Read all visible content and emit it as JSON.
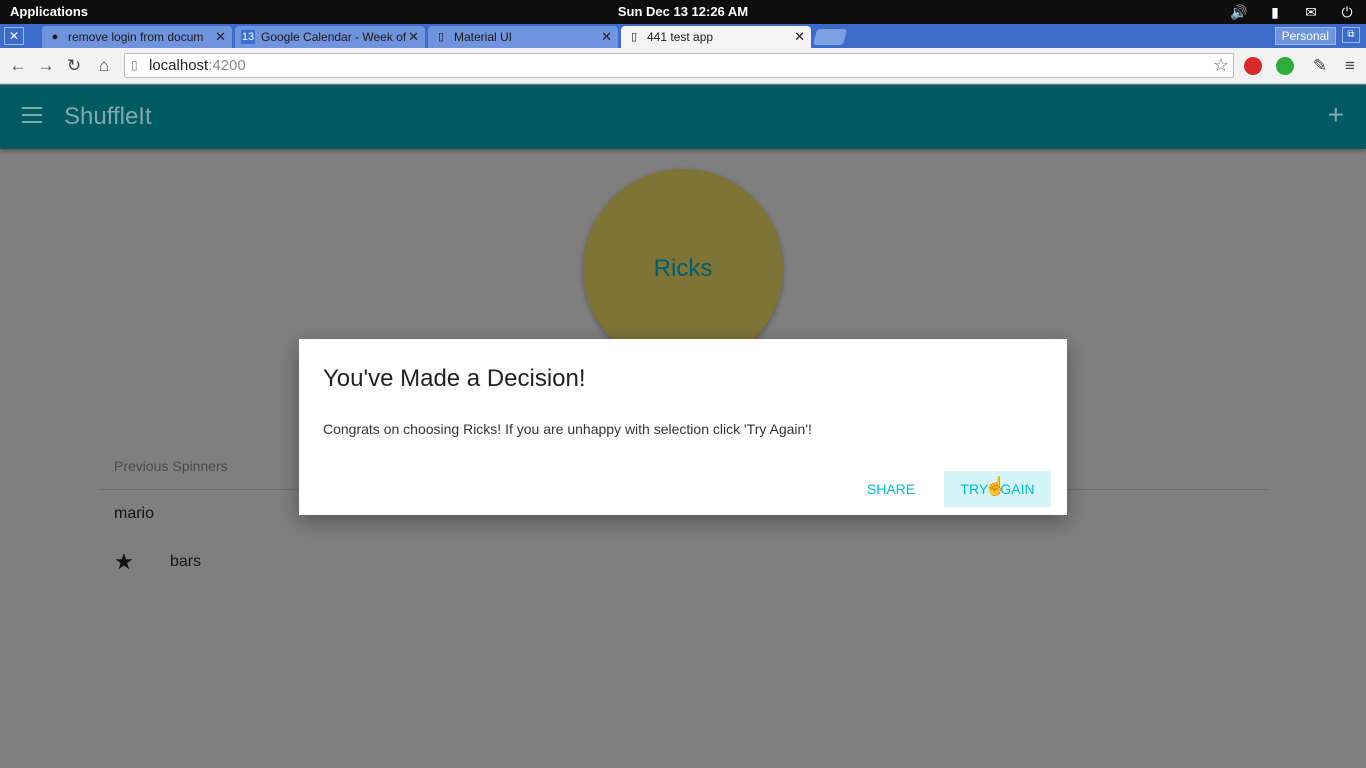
{
  "os_panel": {
    "applications_label": "Applications",
    "clock": "Sun Dec 13 12:26 AM",
    "tray_icons": [
      "volume-icon",
      "battery-icon",
      "mail-icon",
      "power-icon"
    ]
  },
  "browser": {
    "strip_close_glyph": "✕",
    "tabs": [
      {
        "title": "remove login from docum",
        "icon": "github-icon",
        "active": false
      },
      {
        "title": "Google Calendar - Week of",
        "icon": "calendar-icon",
        "icon_text": "13",
        "active": false
      },
      {
        "title": "Material UI",
        "icon": "page-icon",
        "active": false
      },
      {
        "title": "441 test app",
        "icon": "page-icon",
        "active": true
      }
    ],
    "tab_close_glyph": "✕",
    "profile_label": "Personal",
    "url_host": "localhost",
    "url_port": ":4200",
    "accent_colors": {
      "tabstrip": "#3d6bc9",
      "active_tab": "#f4f4f4"
    }
  },
  "app": {
    "title": "ShuffleIt",
    "appbar_color": "#005a62",
    "add_glyph": "+",
    "spinner_label": "Ricks",
    "spinner_color": "#7d7435",
    "previous_spinners_header": "Previous Spinners",
    "previous_spinners": [
      {
        "label": "mario",
        "starred": false
      },
      {
        "label": "bars",
        "starred": true
      }
    ]
  },
  "dialog": {
    "title": "You've Made a Decision!",
    "body": "Congrats on choosing Ricks! If you are unhappy with selection click 'Try Again'!",
    "share_label": "SHARE",
    "try_again_label": "TRY AGAIN",
    "button_color": "#00bcd4"
  }
}
